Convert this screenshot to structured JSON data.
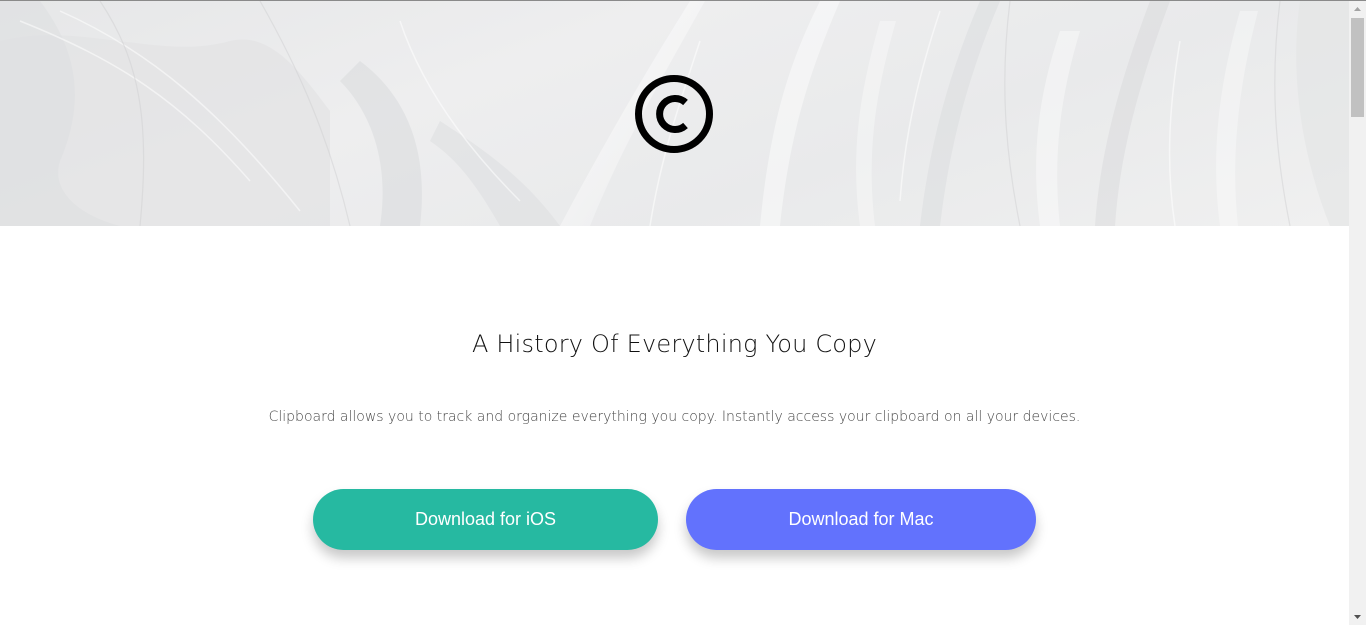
{
  "hero": {
    "logo_icon": "copyright-icon"
  },
  "main": {
    "headline": "A History Of Everything You Copy",
    "description": "Clipboard allows you to track and organize everything you copy. Instantly access your clipboard on all your devices."
  },
  "buttons": {
    "ios_label": "Download for iOS",
    "mac_label": "Download for Mac"
  },
  "colors": {
    "ios_button": "#26b9a1",
    "mac_button": "#6272fd",
    "headline_text": "#111111",
    "description_text": "#4a4a4a"
  },
  "scrollbar": {
    "up_icon": "scroll-up-arrow-icon",
    "down_icon": "scroll-down-arrow-icon"
  }
}
